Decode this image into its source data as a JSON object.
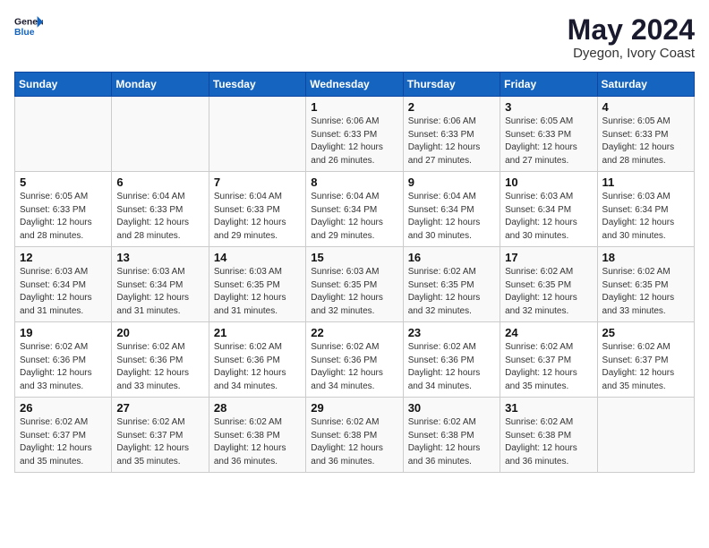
{
  "header": {
    "logo_line1": "General",
    "logo_line2": "Blue",
    "month_year": "May 2024",
    "location": "Dyegon, Ivory Coast"
  },
  "weekdays": [
    "Sunday",
    "Monday",
    "Tuesday",
    "Wednesday",
    "Thursday",
    "Friday",
    "Saturday"
  ],
  "weeks": [
    [
      {
        "day": "",
        "text": ""
      },
      {
        "day": "",
        "text": ""
      },
      {
        "day": "",
        "text": ""
      },
      {
        "day": "1",
        "text": "Sunrise: 6:06 AM\nSunset: 6:33 PM\nDaylight: 12 hours\nand 26 minutes."
      },
      {
        "day": "2",
        "text": "Sunrise: 6:06 AM\nSunset: 6:33 PM\nDaylight: 12 hours\nand 27 minutes."
      },
      {
        "day": "3",
        "text": "Sunrise: 6:05 AM\nSunset: 6:33 PM\nDaylight: 12 hours\nand 27 minutes."
      },
      {
        "day": "4",
        "text": "Sunrise: 6:05 AM\nSunset: 6:33 PM\nDaylight: 12 hours\nand 28 minutes."
      }
    ],
    [
      {
        "day": "5",
        "text": "Sunrise: 6:05 AM\nSunset: 6:33 PM\nDaylight: 12 hours\nand 28 minutes."
      },
      {
        "day": "6",
        "text": "Sunrise: 6:04 AM\nSunset: 6:33 PM\nDaylight: 12 hours\nand 28 minutes."
      },
      {
        "day": "7",
        "text": "Sunrise: 6:04 AM\nSunset: 6:33 PM\nDaylight: 12 hours\nand 29 minutes."
      },
      {
        "day": "8",
        "text": "Sunrise: 6:04 AM\nSunset: 6:34 PM\nDaylight: 12 hours\nand 29 minutes."
      },
      {
        "day": "9",
        "text": "Sunrise: 6:04 AM\nSunset: 6:34 PM\nDaylight: 12 hours\nand 30 minutes."
      },
      {
        "day": "10",
        "text": "Sunrise: 6:03 AM\nSunset: 6:34 PM\nDaylight: 12 hours\nand 30 minutes."
      },
      {
        "day": "11",
        "text": "Sunrise: 6:03 AM\nSunset: 6:34 PM\nDaylight: 12 hours\nand 30 minutes."
      }
    ],
    [
      {
        "day": "12",
        "text": "Sunrise: 6:03 AM\nSunset: 6:34 PM\nDaylight: 12 hours\nand 31 minutes."
      },
      {
        "day": "13",
        "text": "Sunrise: 6:03 AM\nSunset: 6:34 PM\nDaylight: 12 hours\nand 31 minutes."
      },
      {
        "day": "14",
        "text": "Sunrise: 6:03 AM\nSunset: 6:35 PM\nDaylight: 12 hours\nand 31 minutes."
      },
      {
        "day": "15",
        "text": "Sunrise: 6:03 AM\nSunset: 6:35 PM\nDaylight: 12 hours\nand 32 minutes."
      },
      {
        "day": "16",
        "text": "Sunrise: 6:02 AM\nSunset: 6:35 PM\nDaylight: 12 hours\nand 32 minutes."
      },
      {
        "day": "17",
        "text": "Sunrise: 6:02 AM\nSunset: 6:35 PM\nDaylight: 12 hours\nand 32 minutes."
      },
      {
        "day": "18",
        "text": "Sunrise: 6:02 AM\nSunset: 6:35 PM\nDaylight: 12 hours\nand 33 minutes."
      }
    ],
    [
      {
        "day": "19",
        "text": "Sunrise: 6:02 AM\nSunset: 6:36 PM\nDaylight: 12 hours\nand 33 minutes."
      },
      {
        "day": "20",
        "text": "Sunrise: 6:02 AM\nSunset: 6:36 PM\nDaylight: 12 hours\nand 33 minutes."
      },
      {
        "day": "21",
        "text": "Sunrise: 6:02 AM\nSunset: 6:36 PM\nDaylight: 12 hours\nand 34 minutes."
      },
      {
        "day": "22",
        "text": "Sunrise: 6:02 AM\nSunset: 6:36 PM\nDaylight: 12 hours\nand 34 minutes."
      },
      {
        "day": "23",
        "text": "Sunrise: 6:02 AM\nSunset: 6:36 PM\nDaylight: 12 hours\nand 34 minutes."
      },
      {
        "day": "24",
        "text": "Sunrise: 6:02 AM\nSunset: 6:37 PM\nDaylight: 12 hours\nand 35 minutes."
      },
      {
        "day": "25",
        "text": "Sunrise: 6:02 AM\nSunset: 6:37 PM\nDaylight: 12 hours\nand 35 minutes."
      }
    ],
    [
      {
        "day": "26",
        "text": "Sunrise: 6:02 AM\nSunset: 6:37 PM\nDaylight: 12 hours\nand 35 minutes."
      },
      {
        "day": "27",
        "text": "Sunrise: 6:02 AM\nSunset: 6:37 PM\nDaylight: 12 hours\nand 35 minutes."
      },
      {
        "day": "28",
        "text": "Sunrise: 6:02 AM\nSunset: 6:38 PM\nDaylight: 12 hours\nand 36 minutes."
      },
      {
        "day": "29",
        "text": "Sunrise: 6:02 AM\nSunset: 6:38 PM\nDaylight: 12 hours\nand 36 minutes."
      },
      {
        "day": "30",
        "text": "Sunrise: 6:02 AM\nSunset: 6:38 PM\nDaylight: 12 hours\nand 36 minutes."
      },
      {
        "day": "31",
        "text": "Sunrise: 6:02 AM\nSunset: 6:38 PM\nDaylight: 12 hours\nand 36 minutes."
      },
      {
        "day": "",
        "text": ""
      }
    ]
  ]
}
